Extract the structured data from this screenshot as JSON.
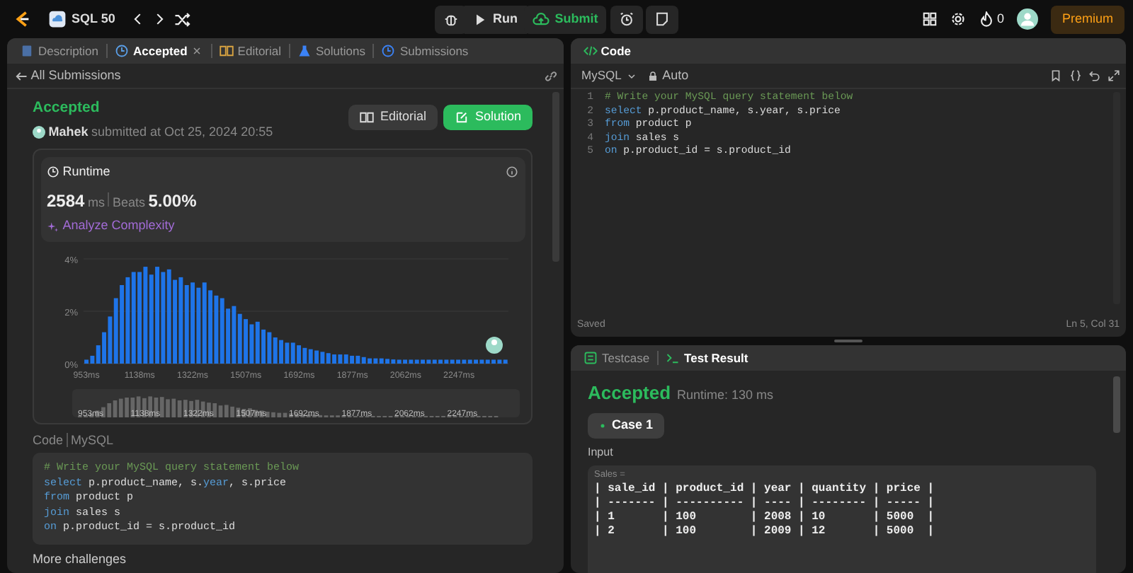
{
  "topbar": {
    "title": "SQL 50",
    "run": "Run",
    "submit": "Submit",
    "streak": "0",
    "premium": "Premium"
  },
  "left": {
    "tabs": [
      {
        "label": "Description",
        "selected": false,
        "closable": false
      },
      {
        "label": "Accepted",
        "selected": true,
        "closable": true
      },
      {
        "label": "Editorial",
        "selected": false,
        "closable": false
      },
      {
        "label": "Solutions",
        "selected": false,
        "closable": false
      },
      {
        "label": "Submissions",
        "selected": false,
        "closable": false
      }
    ],
    "back": "All Submissions",
    "status": "Accepted",
    "user": "Mahek",
    "submitted": "submitted at Oct 25, 2024 20:55",
    "buttons": [
      {
        "kind": "editorial",
        "label": "Editorial"
      },
      {
        "kind": "solution",
        "label": "Solution"
      }
    ],
    "runtime": {
      "title": "Runtime",
      "value": "2584",
      "unit": "ms",
      "beats_label": "Beats",
      "beats": "5.00%",
      "analyze": "Analyze Complexity",
      "chart_data": {
        "type": "bar",
        "ylim": [
          0,
          4
        ],
        "yticks": [
          {
            "value": 0,
            "label": "0%"
          },
          {
            "value": 2,
            "label": "2%"
          },
          {
            "value": 4,
            "label": "4%"
          }
        ],
        "xlim": [
          943,
          2419
        ],
        "xticks": [
          {
            "value": 953,
            "label": "953ms"
          },
          {
            "value": 1138,
            "label": "1138ms"
          },
          {
            "value": 1322,
            "label": "1322ms"
          },
          {
            "value": 1507,
            "label": "1507ms"
          },
          {
            "value": 1692,
            "label": "1692ms"
          },
          {
            "value": 1877,
            "label": "1877ms"
          },
          {
            "value": 2062,
            "label": "2062ms"
          },
          {
            "value": 2247,
            "label": "2247ms"
          }
        ],
        "x": [
          953,
          973.5,
          994,
          1014.5,
          1035,
          1055.5,
          1076,
          1096.5,
          1117,
          1137.5,
          1158,
          1178.5,
          1199,
          1219.5,
          1240,
          1260.5,
          1281,
          1301.5,
          1322,
          1342.5,
          1363,
          1383.5,
          1404,
          1424.5,
          1445,
          1465.5,
          1486,
          1506.5,
          1527,
          1547.5,
          1568,
          1588.5,
          1609,
          1629.5,
          1650,
          1670.5,
          1691,
          1711.5,
          1732,
          1752.5,
          1773,
          1793.5,
          1814,
          1834.5,
          1855,
          1875.5,
          1896,
          1916.5,
          1937,
          1957.5,
          1978,
          1998.5,
          2019,
          2039.5,
          2060,
          2080.5,
          2101,
          2121.5,
          2142,
          2162.5,
          2183,
          2203.5,
          2224,
          2244.5,
          2265,
          2285.5,
          2306,
          2326.5,
          2347,
          2367.5,
          2388,
          2408.5
        ],
        "values": [
          0.15,
          0.3,
          0.7,
          1.2,
          1.8,
          2.5,
          3.0,
          3.3,
          3.5,
          3.5,
          3.7,
          3.4,
          3.7,
          3.5,
          3.6,
          3.2,
          3.3,
          3.0,
          3.1,
          2.9,
          3.1,
          2.8,
          2.6,
          2.5,
          2.1,
          2.2,
          1.9,
          1.7,
          1.5,
          1.6,
          1.3,
          1.2,
          1.0,
          0.9,
          0.8,
          0.8,
          0.7,
          0.6,
          0.55,
          0.5,
          0.45,
          0.4,
          0.35,
          0.35,
          0.35,
          0.3,
          0.3,
          0.25,
          0.2,
          0.2,
          0.2,
          0.18,
          0.16,
          0.15,
          0.15,
          0.15,
          0.15,
          0.15,
          0.15,
          0.15,
          0.15,
          0.15,
          0.15,
          0.15,
          0.15,
          0.15,
          0.15,
          0.15,
          0.15,
          0.15,
          0.15,
          0.15
        ]
      },
      "navigator_labels": [
        "953ms",
        "1138ms",
        "1322ms",
        "1507ms",
        "1692ms",
        "1877ms",
        "2062ms",
        "2247ms"
      ]
    },
    "code_label": "Code",
    "language": "MySQL",
    "code": [
      [
        {
          "kind": "comment",
          "text": "# Write your MySQL query statement below"
        }
      ],
      [
        {
          "kind": "keyword",
          "text": "select"
        },
        {
          "kind": "plain",
          "text": " p.product_name, s."
        },
        {
          "kind": "keyword",
          "text": "year"
        },
        {
          "kind": "plain",
          "text": ", s.price"
        }
      ],
      [
        {
          "kind": "keyword",
          "text": "from"
        },
        {
          "kind": "plain",
          "text": " product p"
        }
      ],
      [
        {
          "kind": "keyword",
          "text": "join"
        },
        {
          "kind": "plain",
          "text": " sales s"
        }
      ],
      [
        {
          "kind": "keyword",
          "text": "on"
        },
        {
          "kind": "plain",
          "text": " p.product_id = s.product_id"
        }
      ]
    ],
    "more": "More challenges"
  },
  "editor": {
    "title": "Code",
    "language": "MySQL",
    "mode": "Auto",
    "lines": [
      {
        "number": "1",
        "tokens": [
          {
            "kind": "comment",
            "text": "# Write your MySQL query statement below"
          }
        ]
      },
      {
        "number": "2",
        "tokens": [
          {
            "kind": "keyword",
            "text": "select"
          },
          {
            "kind": "plain",
            "text": " p.product_name, s.year, s.price"
          }
        ]
      },
      {
        "number": "3",
        "tokens": [
          {
            "kind": "keyword",
            "text": "from"
          },
          {
            "kind": "plain",
            "text": " product p"
          }
        ]
      },
      {
        "number": "4",
        "tokens": [
          {
            "kind": "keyword",
            "text": "join"
          },
          {
            "kind": "plain",
            "text": " sales s"
          }
        ]
      },
      {
        "number": "5",
        "tokens": [
          {
            "kind": "keyword",
            "text": "on"
          },
          {
            "kind": "plain",
            "text": " p.product_id = s.product_id"
          }
        ]
      }
    ],
    "status": "Saved",
    "cursor": "Ln 5, Col 31"
  },
  "result": {
    "tabs": [
      {
        "label": "Testcase",
        "selected": false
      },
      {
        "label": "Test Result",
        "selected": true
      }
    ],
    "status": "Accepted",
    "runtime": "Runtime: 130 ms",
    "cases": [
      {
        "label": "Case 1",
        "selected": true
      }
    ],
    "input_label": "Input",
    "table_name": "Sales =",
    "table_lines": [
      "| sale_id | product_id | year | quantity | price |",
      "| ------- | ---------- | ---- | -------- | ----- |",
      "| 1       | 100        | 2008 | 10       | 5000  |",
      "| 2       | 100        | 2009 | 12       | 5000  |"
    ]
  }
}
